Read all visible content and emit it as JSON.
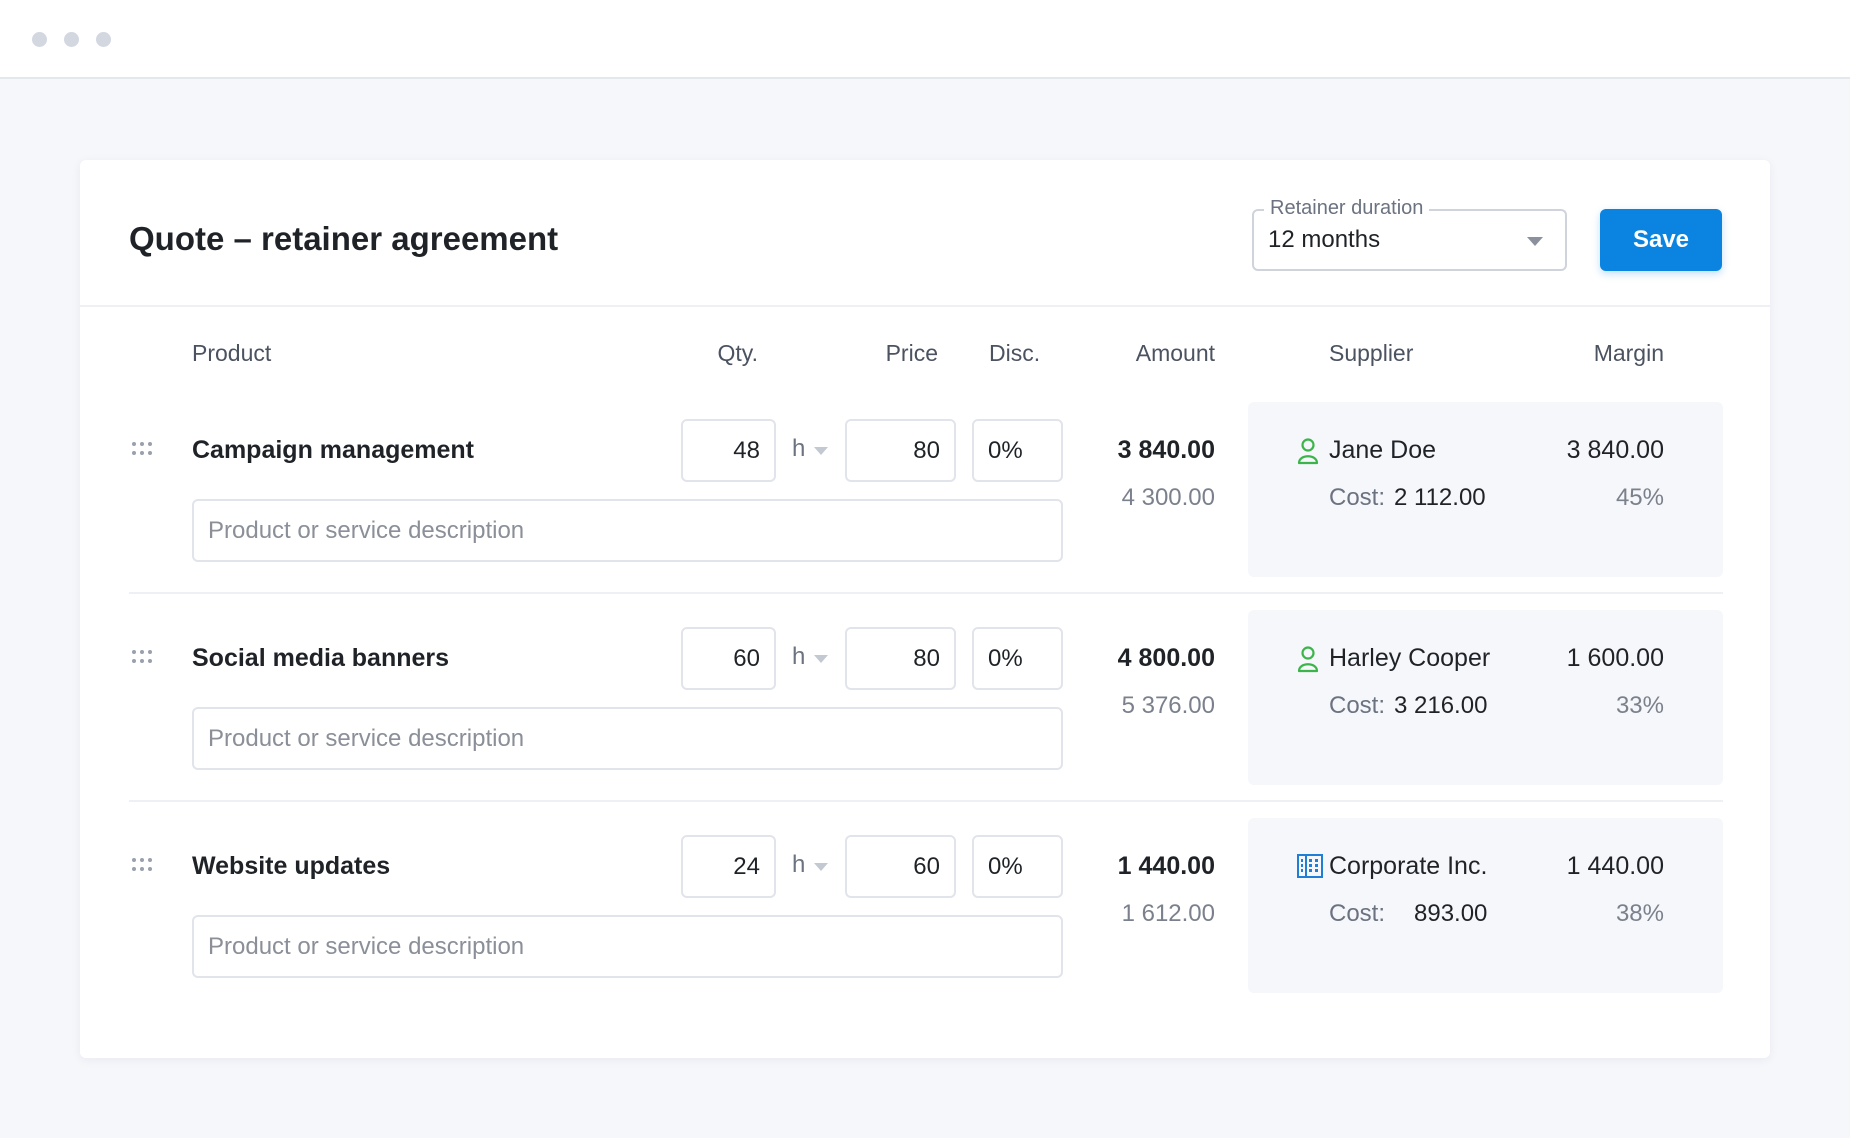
{
  "window": {
    "dots": 3
  },
  "header": {
    "title": "Quote – retainer agreement",
    "duration_label": "Retainer duration",
    "duration_value": "12 months",
    "save_label": "Save"
  },
  "columns": {
    "product": "Product",
    "qty": "Qty.",
    "price": "Price",
    "disc": "Disc.",
    "amount": "Amount",
    "supplier": "Supplier",
    "margin": "Margin"
  },
  "colors": {
    "accent": "#0a84e0",
    "person_icon": "#3bb54a",
    "company_icon": "#1f7fd6"
  },
  "rows": [
    {
      "name": "Campaign management",
      "qty": "48",
      "unit": "h",
      "price": "80",
      "disc": "0%",
      "description_placeholder": "Product or service description",
      "amount": "3 840.00",
      "amount_sub": "4 300.00",
      "supplier_icon": "person-icon",
      "supplier": "Jane Doe",
      "margin": "3 840.00",
      "cost_label": "Cost:",
      "cost": "2 112.00",
      "margin_pct": "45%"
    },
    {
      "name": "Social media banners",
      "qty": "60",
      "unit": "h",
      "price": "80",
      "disc": "0%",
      "description_placeholder": "Product or service description",
      "amount": "4 800.00",
      "amount_sub": "5 376.00",
      "supplier_icon": "person-icon",
      "supplier": "Harley Cooper",
      "margin": "1 600.00",
      "cost_label": "Cost:",
      "cost": "3 216.00",
      "margin_pct": "33%"
    },
    {
      "name": "Website updates",
      "qty": "24",
      "unit": "h",
      "price": "60",
      "disc": "0%",
      "description_placeholder": "Product or service description",
      "amount": "1 440.00",
      "amount_sub": "1 612.00",
      "supplier_icon": "building-icon",
      "supplier": "Corporate Inc.",
      "margin": "1 440.00",
      "cost_label": "Cost:",
      "cost": "893.00",
      "margin_pct": "38%"
    }
  ]
}
